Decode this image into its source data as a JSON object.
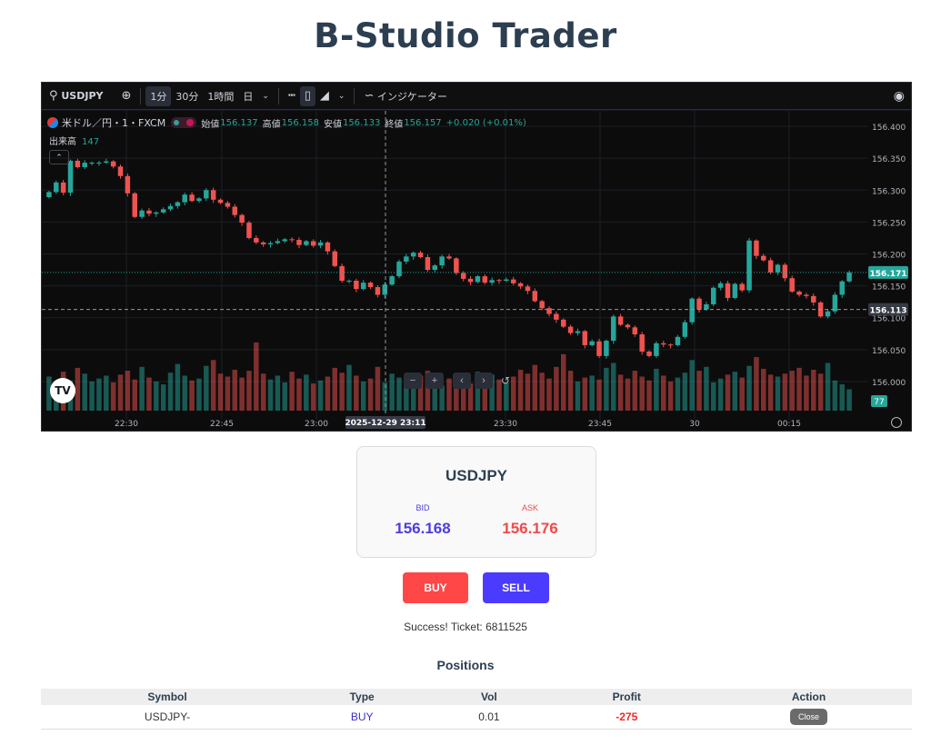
{
  "app": {
    "title": "B-Studio Trader"
  },
  "toolbar": {
    "symbol": "USDJPY",
    "intervals": [
      "1分",
      "30分",
      "1時間",
      "日"
    ],
    "indicators_label": "インジケーター"
  },
  "legend": {
    "instrument": "米ドル／円・1・FXCM",
    "open_label": "始値",
    "open": "156.137",
    "high_label": "高値",
    "high": "156.158",
    "low_label": "安値",
    "low": "156.133",
    "close_label": "終値",
    "close": "156.157",
    "change": "+0.020 (+0.01%)",
    "volume_label": "出来高",
    "volume": "147"
  },
  "chart_data": {
    "type": "candlestick",
    "symbol": "USDJPY",
    "y_ticks": [
      "156.400",
      "156.350",
      "156.300",
      "156.250",
      "156.200",
      "156.150",
      "156.100",
      "156.050",
      "156.000"
    ],
    "ylim": [
      155.99,
      156.41
    ],
    "x_ticks": [
      "22:30",
      "22:45",
      "23:00",
      "23:30",
      "23:45",
      "30",
      "00:15"
    ],
    "crosshair_time": "2025-12-29  23:11",
    "last_price": "156.171",
    "crosshair_price": "156.113",
    "last_volume": "77",
    "up_color": "#26a69a",
    "down_color": "#ef5350",
    "closes": [
      156.297,
      156.312,
      156.296,
      156.346,
      156.336,
      156.343,
      156.343,
      156.343,
      156.345,
      156.337,
      156.322,
      156.295,
      156.258,
      156.268,
      156.263,
      156.265,
      156.27,
      156.275,
      156.281,
      156.293,
      156.283,
      156.287,
      156.3,
      156.285,
      156.28,
      156.274,
      156.261,
      156.249,
      156.225,
      156.218,
      156.215,
      156.217,
      156.22,
      156.223,
      156.222,
      156.214,
      156.22,
      156.213,
      156.218,
      156.204,
      156.181,
      156.158,
      156.158,
      156.145,
      156.155,
      156.148,
      156.136,
      156.152,
      156.165,
      156.188,
      156.196,
      156.202,
      156.195,
      156.175,
      156.182,
      156.196,
      156.193,
      156.17,
      156.161,
      156.156,
      156.165,
      156.155,
      156.159,
      156.158,
      156.16,
      156.154,
      156.149,
      156.142,
      156.126,
      156.115,
      156.106,
      156.097,
      156.086,
      156.076,
      156.079,
      156.057,
      156.063,
      156.04,
      156.064,
      156.102,
      156.089,
      156.085,
      156.074,
      156.047,
      156.04,
      156.06,
      156.058,
      156.057,
      156.07,
      156.093,
      156.13,
      156.113,
      156.121,
      156.147,
      156.154,
      156.131,
      156.153,
      156.143,
      156.221,
      156.197,
      156.19,
      156.171,
      156.183,
      156.162,
      156.141,
      156.136,
      156.134,
      156.124,
      156.102,
      156.11,
      156.136,
      156.157,
      156.171
    ],
    "volumes": [
      35,
      28,
      40,
      31,
      44,
      38,
      30,
      33,
      36,
      29,
      37,
      41,
      32,
      45,
      34,
      30,
      27,
      39,
      48,
      36,
      31,
      33,
      46,
      52,
      38,
      35,
      42,
      34,
      41,
      70,
      38,
      32,
      36,
      29,
      40,
      33,
      37,
      28,
      31,
      35,
      44,
      39,
      47,
      36,
      30,
      33,
      45,
      29,
      38,
      34,
      27,
      32,
      36,
      41,
      30,
      26,
      33,
      35,
      31,
      28,
      40,
      34,
      37,
      32,
      29,
      35,
      42,
      38,
      47,
      39,
      33,
      45,
      58,
      41,
      30,
      34,
      36,
      32,
      44,
      49,
      37,
      33,
      41,
      35,
      31,
      43,
      36,
      30,
      34,
      39,
      52,
      41,
      45,
      29,
      33,
      37,
      40,
      34,
      46,
      55,
      43,
      37,
      35,
      38,
      41,
      44,
      36,
      42,
      38,
      49,
      31,
      27,
      22
    ],
    "grid": true
  },
  "quote": {
    "symbol": "USDJPY",
    "bid_label": "BID",
    "bid": "156.168",
    "ask_label": "ASK",
    "ask": "156.176"
  },
  "actions": {
    "buy_label": "BUY",
    "sell_label": "SELL"
  },
  "status": "Success! Ticket: 6811525",
  "positions": {
    "title": "Positions",
    "headers": [
      "Symbol",
      "Type",
      "Vol",
      "Profit",
      "Action"
    ],
    "rows": [
      {
        "symbol": "USDJPY-",
        "type": "BUY",
        "vol": "0.01",
        "profit": "-275",
        "action": "Close"
      }
    ]
  }
}
